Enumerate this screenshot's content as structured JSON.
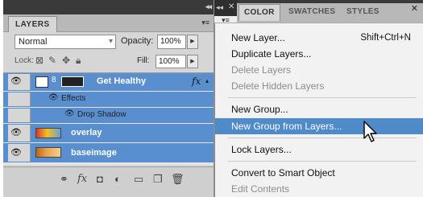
{
  "layers_panel": {
    "tab_label": "LAYERS",
    "collapse_glyph": "◂◂",
    "menu_glyph": "▾≡",
    "blend_mode": "Normal",
    "opacity_label": "Opacity:",
    "opacity_value": "100%",
    "lock_label": "Lock:",
    "fill_label": "Fill:",
    "fill_value": "100%",
    "layers": [
      {
        "name": "Get Healthy",
        "selected": true,
        "visible": true,
        "has_fx": true,
        "fx_glyph": "fx",
        "sub_items": [
          "Effects",
          "Drop Shadow"
        ]
      },
      {
        "name": "overlay",
        "selected": true,
        "visible": true,
        "has_fx": false
      },
      {
        "name": "baseimage",
        "selected": true,
        "visible": true,
        "has_fx": false
      }
    ],
    "bottom_icons": [
      "link-icon",
      "fx-icon",
      "mask-icon",
      "adjustment-icon",
      "folder-icon",
      "new-layer-icon",
      "trash-icon"
    ]
  },
  "color_panel": {
    "tabs": [
      "COLOR",
      "SWATCHES",
      "STYLES"
    ],
    "active_tab": "COLOR",
    "collapse_glyph": "◂◂",
    "close_glyph": "✕"
  },
  "context_menu": {
    "items": [
      {
        "label": "New Layer...",
        "shortcut": "Shift+Ctrl+N",
        "enabled": true
      },
      {
        "label": "Duplicate Layers...",
        "enabled": true
      },
      {
        "label": "Delete Layers",
        "enabled": false
      },
      {
        "label": "Delete Hidden Layers",
        "enabled": false
      },
      {
        "label": "New Group...",
        "enabled": true
      },
      {
        "label": "New Group from Layers...",
        "enabled": true,
        "highlighted": true
      },
      {
        "label": "Lock Layers...",
        "enabled": true
      },
      {
        "label": "Convert to Smart Object",
        "enabled": true
      },
      {
        "label": "Edit Contents",
        "enabled": false
      }
    ]
  },
  "colors": {
    "selection_blue": "#5a8fcf",
    "menu_highlight": "#4f8acb",
    "panel_gray": "#d6d6d6",
    "disabled_text": "#8c8c8c"
  }
}
